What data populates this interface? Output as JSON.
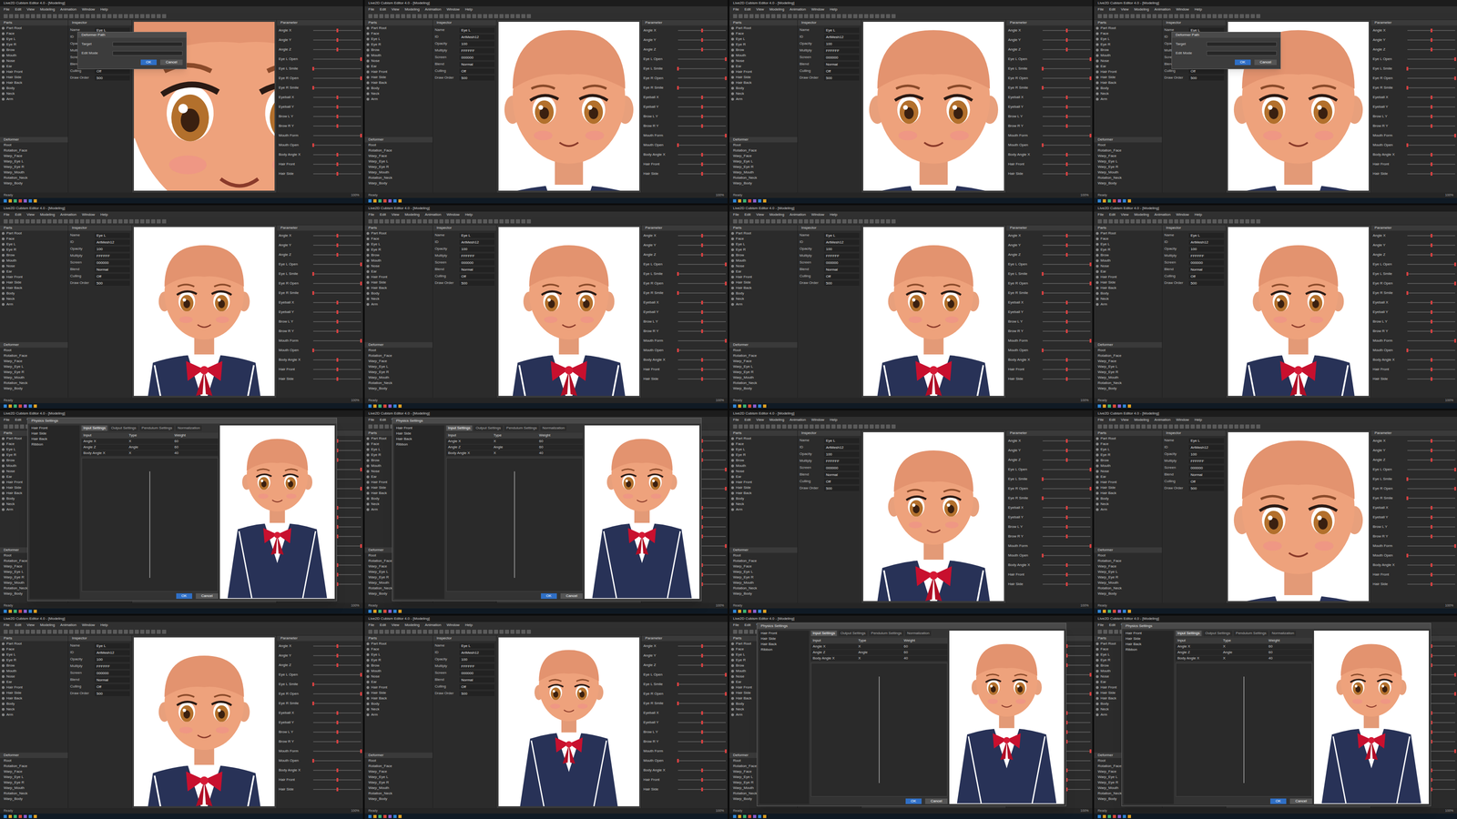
{
  "app": {
    "title": "Live2D Cubism Editor 4.0 - [Modeling]",
    "menus": [
      "File",
      "Edit",
      "View",
      "Modeling",
      "Animation",
      "Window",
      "Help"
    ],
    "panels": {
      "parts": "Parts",
      "deformer": "Deformer",
      "inspector": "Inspector",
      "parameter": "Parameter"
    },
    "parts": [
      "Part Root",
      "Face",
      "Eye L",
      "Eye R",
      "Brow",
      "Mouth",
      "Nose",
      "Ear",
      "Hair Front",
      "Hair Side",
      "Hair Back",
      "Body",
      "Neck",
      "Arm"
    ],
    "deformers": [
      "Root",
      "Rotation_Face",
      "Warp_Face",
      "Warp_Eye L",
      "Warp_Eye R",
      "Warp_Mouth",
      "Rotation_Neck",
      "Warp_Body"
    ],
    "inspector": [
      {
        "label": "Name",
        "value": "Eye L"
      },
      {
        "label": "ID",
        "value": "ArtMesh12"
      },
      {
        "label": "Opacity",
        "value": "100"
      },
      {
        "label": "Multiply",
        "value": "FFFFFF"
      },
      {
        "label": "Screen",
        "value": "000000"
      },
      {
        "label": "Blend",
        "value": "Normal"
      },
      {
        "label": "Culling",
        "value": "Off"
      },
      {
        "label": "Draw Order",
        "value": "500"
      }
    ],
    "parameters": [
      {
        "name": "Angle X",
        "level": 0.5
      },
      {
        "name": "Angle Y",
        "level": 0.5
      },
      {
        "name": "Angle Z",
        "level": 0.5
      },
      {
        "name": "Eye L Open",
        "level": 1
      },
      {
        "name": "Eye L Smile",
        "level": 0
      },
      {
        "name": "Eye R Open",
        "level": 1
      },
      {
        "name": "Eye R Smile",
        "level": 0
      },
      {
        "name": "Eyeball X",
        "level": 0.5
      },
      {
        "name": "Eyeball Y",
        "level": 0.5
      },
      {
        "name": "Brow L Y",
        "level": 0.5
      },
      {
        "name": "Brow R Y",
        "level": 0.5
      },
      {
        "name": "Mouth Form",
        "level": 1
      },
      {
        "name": "Mouth Open",
        "level": 0
      },
      {
        "name": "Body Angle X",
        "level": 0.5
      },
      {
        "name": "Hair Front",
        "level": 0.5
      },
      {
        "name": "Hair Side",
        "level": 0.5
      }
    ],
    "status": "Ready",
    "zoom": "100%"
  },
  "small_dialog": {
    "title": "Deformer Path",
    "lines": [
      "Target",
      "Edit Mode"
    ],
    "buttons": [
      "OK",
      "Cancel"
    ]
  },
  "physics": {
    "title": "Physics Settings",
    "groups": [
      "Hair Front",
      "Hair Side",
      "Hair Back",
      "Ribbon"
    ],
    "tabs": [
      {
        "label": "Input Settings",
        "selected": true
      },
      {
        "label": "Output Settings",
        "selected": false
      },
      {
        "label": "Pendulum Settings",
        "selected": false
      },
      {
        "label": "Normalization",
        "selected": false
      }
    ],
    "columns": [
      "Input",
      "Type",
      "Weight"
    ],
    "rows": [
      [
        "Angle X",
        "X",
        "60"
      ],
      [
        "Angle Z",
        "Angle",
        "60"
      ],
      [
        "Body Angle X",
        "X",
        "40"
      ]
    ],
    "buttons": [
      "OK",
      "Cancel"
    ]
  },
  "tiles": [
    {
      "view": "eye",
      "dialog": "small"
    },
    {
      "view": "closeup",
      "dialog": "none"
    },
    {
      "view": "closeup",
      "dialog": "none"
    },
    {
      "view": "closeup",
      "dialog": "small"
    },
    {
      "view": "bust",
      "dialog": "none"
    },
    {
      "view": "bust",
      "dialog": "none"
    },
    {
      "view": "bust",
      "dialog": "none"
    },
    {
      "view": "bust",
      "dialog": "none"
    },
    {
      "view": "full",
      "dialog": "physics"
    },
    {
      "view": "full",
      "dialog": "physics"
    },
    {
      "view": "bust",
      "dialog": "none"
    },
    {
      "view": "closeup",
      "dialog": "none"
    },
    {
      "view": "bust",
      "dialog": "none"
    },
    {
      "view": "full",
      "dialog": "none"
    },
    {
      "view": "full",
      "dialog": "physics"
    },
    {
      "view": "full",
      "dialog": "physics"
    }
  ]
}
